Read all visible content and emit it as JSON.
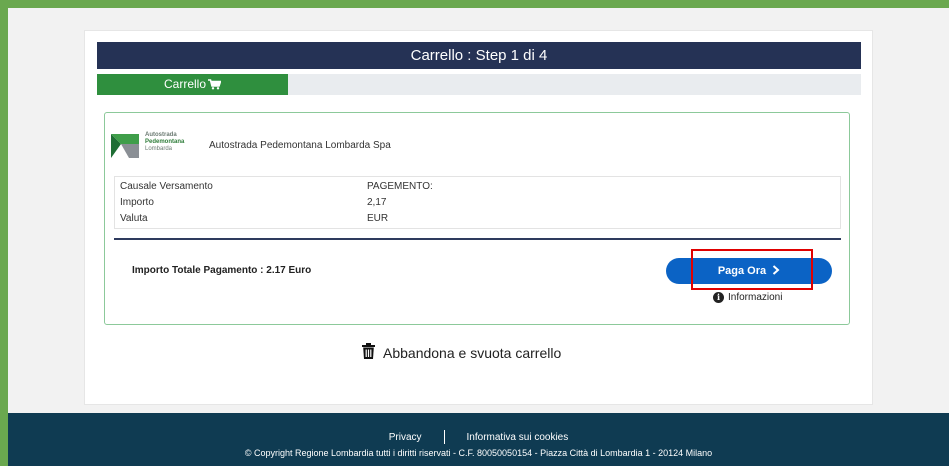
{
  "header": {
    "title": "Carrello : Step 1 di 4"
  },
  "progress": {
    "label": "Carrello",
    "step": 1,
    "total_steps": 4,
    "fraction": 0.25
  },
  "creditor": {
    "logo_lines": [
      "Autostrada",
      "Pedemontana",
      "Lombarda"
    ],
    "name": "Autostrada Pedemontana Lombarda Spa"
  },
  "details": [
    {
      "label": "Causale Versamento",
      "value": "PAGEMENTO:"
    },
    {
      "label": "Importo",
      "value": "2,17"
    },
    {
      "label": "Valuta",
      "value": "EUR"
    }
  ],
  "total": {
    "text": "Importo Totale Pagamento : 2.17 Euro"
  },
  "actions": {
    "pay_label": "Paga Ora",
    "info_label": "Informazioni",
    "abandon_label": "Abbandona e svuota carrello"
  },
  "footer": {
    "privacy": "Privacy",
    "cookies": "Informativa sui cookies",
    "copyright": "© Copyright Regione Lombardia tutti i diritti riservati - C.F. 80050050154 - Piazza Città di Lombardia 1 - 20124 Milano"
  },
  "colors": {
    "header_bg": "#253255",
    "progress_fill": "#2f8f3e",
    "pay_button": "#0b63c5",
    "footer_bg": "#0f3b52",
    "page_border": "#6aa84f",
    "highlight": "#e00000"
  },
  "icons": {
    "cart": "shopping-cart-icon",
    "chevron": "chevron-right-icon",
    "info": "info-circle-icon",
    "trash": "trash-icon"
  }
}
